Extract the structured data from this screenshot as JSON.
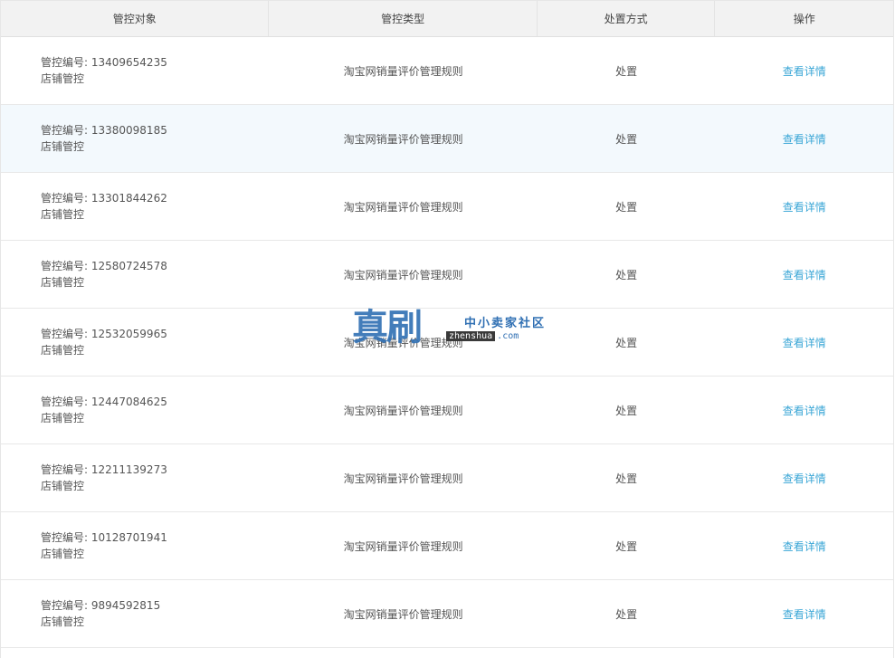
{
  "headers": {
    "object": "管控对象",
    "type": "管控类型",
    "method": "处置方式",
    "action": "操作"
  },
  "rows": [
    {
      "id_label": "管控编号: 13409654235",
      "scope": "店铺管控",
      "type": "淘宝网销量评价管理规则",
      "method": "处置",
      "action": "查看详情"
    },
    {
      "id_label": "管控编号: 13380098185",
      "scope": "店铺管控",
      "type": "淘宝网销量评价管理规则",
      "method": "处置",
      "action": "查看详情"
    },
    {
      "id_label": "管控编号: 13301844262",
      "scope": "店铺管控",
      "type": "淘宝网销量评价管理规则",
      "method": "处置",
      "action": "查看详情"
    },
    {
      "id_label": "管控编号: 12580724578",
      "scope": "店铺管控",
      "type": "淘宝网销量评价管理规则",
      "method": "处置",
      "action": "查看详情"
    },
    {
      "id_label": "管控编号: 12532059965",
      "scope": "店铺管控",
      "type": "淘宝网销量评价管理规则",
      "method": "处置",
      "action": "查看详情"
    },
    {
      "id_label": "管控编号: 12447084625",
      "scope": "店铺管控",
      "type": "淘宝网销量评价管理规则",
      "method": "处置",
      "action": "查看详情"
    },
    {
      "id_label": "管控编号: 12211139273",
      "scope": "店铺管控",
      "type": "淘宝网销量评价管理规则",
      "method": "处置",
      "action": "查看详情"
    },
    {
      "id_label": "管控编号: 10128701941",
      "scope": "店铺管控",
      "type": "淘宝网销量评价管理规则",
      "method": "处置",
      "action": "查看详情"
    },
    {
      "id_label": "管控编号: 9894592815",
      "scope": "店铺管控",
      "type": "淘宝网销量评价管理规则",
      "method": "处置",
      "action": "查看详情"
    }
  ],
  "watermark": {
    "logo": "真刷",
    "tagline": "中小卖家社区",
    "domain_name": "zhenshua",
    "domain_tld": ".com"
  },
  "colors": {
    "link": "#3aa6d6",
    "header_bg": "#f2f2f2",
    "highlight_row_bg": "#f3f9fd",
    "watermark": "#2f6fb3"
  }
}
